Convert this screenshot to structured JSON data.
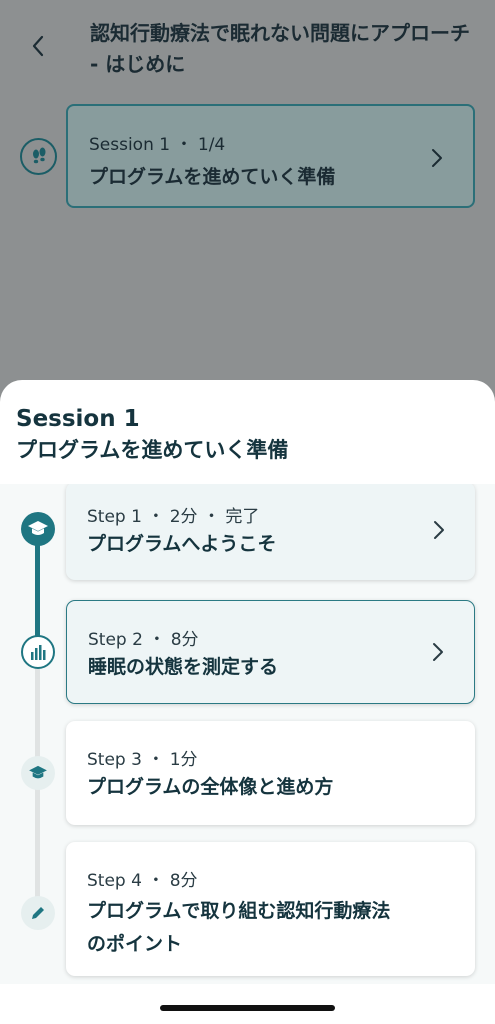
{
  "header": {
    "back_icon": "chevron-left-icon",
    "title": "認知行動療法で眠れない問題にアプローチ - はじめに"
  },
  "current_session": {
    "icon": "footsteps-icon",
    "meta": "Session 1 ・ 1/4",
    "name": "プログラムを進めていく準備"
  },
  "sheet": {
    "session_number": "Session 1",
    "session_name": "プログラムを進めていく準備",
    "steps": [
      {
        "meta": "Step 1 ・ 2分 ・ 完了",
        "name": "プログラムへようこそ",
        "status": "completed",
        "icon": "graduation-cap-icon"
      },
      {
        "meta": "Step 2 ・ 8分",
        "name": "睡眠の状態を測定する",
        "status": "current",
        "icon": "bar-chart-icon"
      },
      {
        "meta": "Step 3 ・ 1分",
        "name": "プログラムの全体像と進め方",
        "status": "locked",
        "icon": "graduation-cap-icon"
      },
      {
        "meta": "Step 4 ・ 8分",
        "name": "プログラムで取り組む認知行動療法のポイント",
        "status": "locked",
        "icon": "pencil-icon"
      }
    ]
  },
  "colors": {
    "accent": "#1f7682",
    "text_dark": "#15343e",
    "overlay": "#8d9091"
  }
}
